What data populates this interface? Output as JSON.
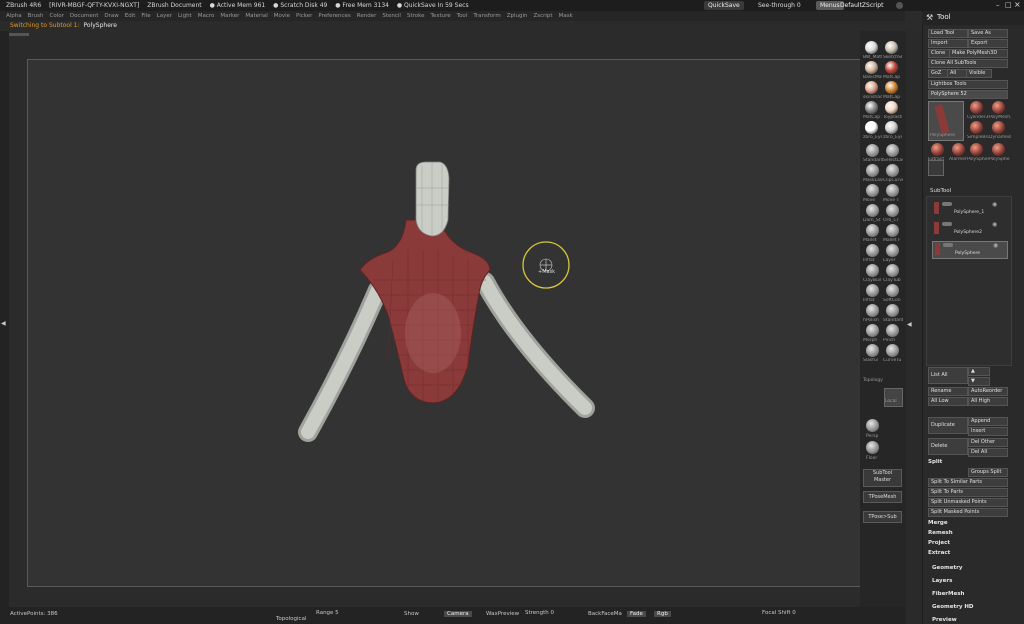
{
  "titlebar": {
    "app": "ZBrush 4R6",
    "serial": "[RIVR-MBGF-QFTY-KVXI-NGXT]",
    "doc": "ZBrush Document",
    "active_mem": "● Active Mem 961",
    "scratch": "● Scratch Disk 49",
    "free_mem": "● Free Mem 3134",
    "quicksave": "● QuickSave In 59 Secs",
    "quicksave_btn": "QuickSave",
    "seethrough": "See-through",
    "seethrough_val": "0",
    "menus_btn": "Menus",
    "script": "DefaultZScript"
  },
  "menubar": [
    "Alpha",
    "Brush",
    "Color",
    "Document",
    "Draw",
    "Edit",
    "File",
    "Layer",
    "Light",
    "Macro",
    "Marker",
    "Material",
    "Movie",
    "Picker",
    "Preferences",
    "Render",
    "Stencil",
    "Stroke",
    "Texture",
    "Tool",
    "Transform",
    "Zplugin",
    "Zscript",
    "Mask"
  ],
  "status": {
    "label": "Switching to Subtool 1:",
    "value": "PolySphere"
  },
  "cursor_label": "+Mask",
  "shelf": {
    "materials": [
      "BW_MatCap",
      "SketchShaded",
      "BasicMaterial",
      "MatCap Red",
      "skinshade4",
      "MatCap Orange",
      "MatCap Gray",
      "Toyplastic",
      "zbro_Eye",
      "zbro_Eye"
    ],
    "brush_labels": [
      "Standard",
      "SelectLasso",
      "MaskLasso",
      "ClipCurve",
      "Move",
      "Move T",
      "Dam_St",
      "Orb_Cr",
      "Mallet",
      "Mallet F",
      "Inflat",
      "Layer",
      "ClayBuil",
      "ClayTub",
      "Inflat",
      "SoftCon",
      "hPolish",
      "Standard",
      "Morph",
      "Pinch",
      "Slash3",
      "CurveTu"
    ],
    "topo": "Topology",
    "local": "Local",
    "persp": "Persp",
    "floor": "Floor",
    "subtool_master": "SubTool Master",
    "tposemesh": "TPoseMesh",
    "tposesub": "TPose>Sub"
  },
  "toolpanel": {
    "title": "Tool",
    "load_tool": "Load Tool",
    "save_as": "Save As",
    "import": "Import",
    "export": "Export",
    "clone": "Clone",
    "make_polymesh": "Make PolyMesh3D",
    "clone_all": "Clone All SubTools",
    "goz": "GoZ",
    "all": "All",
    "visible": "Visible",
    "lightbox": "Lightbox Tools",
    "polysphere": "PolySphere",
    "polysphere_val": "52",
    "tool_thumbs": [
      "PolySphere",
      "Cylinder3D",
      "PolyMesh3D",
      "SimpleBrush",
      "Dynamesh",
      "Extract",
      "Alarmer",
      "PolySphere",
      "PolySphe"
    ],
    "subtool": "SubTool",
    "subtools": [
      "PolySphere_1",
      "PolySphere2",
      "PolySphere"
    ],
    "list_all": "List All",
    "rename": "Rename",
    "autoreorder": "AutoReorder",
    "all_low": "All Low",
    "all_high": "All High",
    "duplicate": "Duplicate",
    "append": "Append",
    "insert": "Insert",
    "delete": "Delete",
    "del_other": "Del Other",
    "del_all": "Del All",
    "split": "Split",
    "groups_split": "Groups Split",
    "split_similar": "Split To Similar Parts",
    "split_parts": "Split To Parts",
    "split_unmasked": "Split Unmasked Points",
    "split_masked": "Split Masked Points",
    "merge": "Merge",
    "remesh": "Remesh",
    "project": "Project",
    "extract": "Extract",
    "geometry": "Geometry",
    "layers": "Layers",
    "fibermesh": "FiberMesh",
    "geometry_hd": "Geometry HD",
    "preview": "Preview"
  },
  "bottombar": {
    "active_points": "ActivePoints: 386",
    "topological": "Topological",
    "range": "Range 5",
    "show": "Show",
    "camera": "Camera",
    "wax": "WaxPreview",
    "strength": "Strength 0",
    "backface": "BackFaceMa",
    "fade": "Fade",
    "rgb": "Rgb",
    "focal": "Focal Shift 0"
  },
  "colors": {
    "accent": "#e09a2a",
    "mesh_red": "#8b3a3a",
    "limb": "#c9cdc5",
    "canvas": "#333333"
  }
}
